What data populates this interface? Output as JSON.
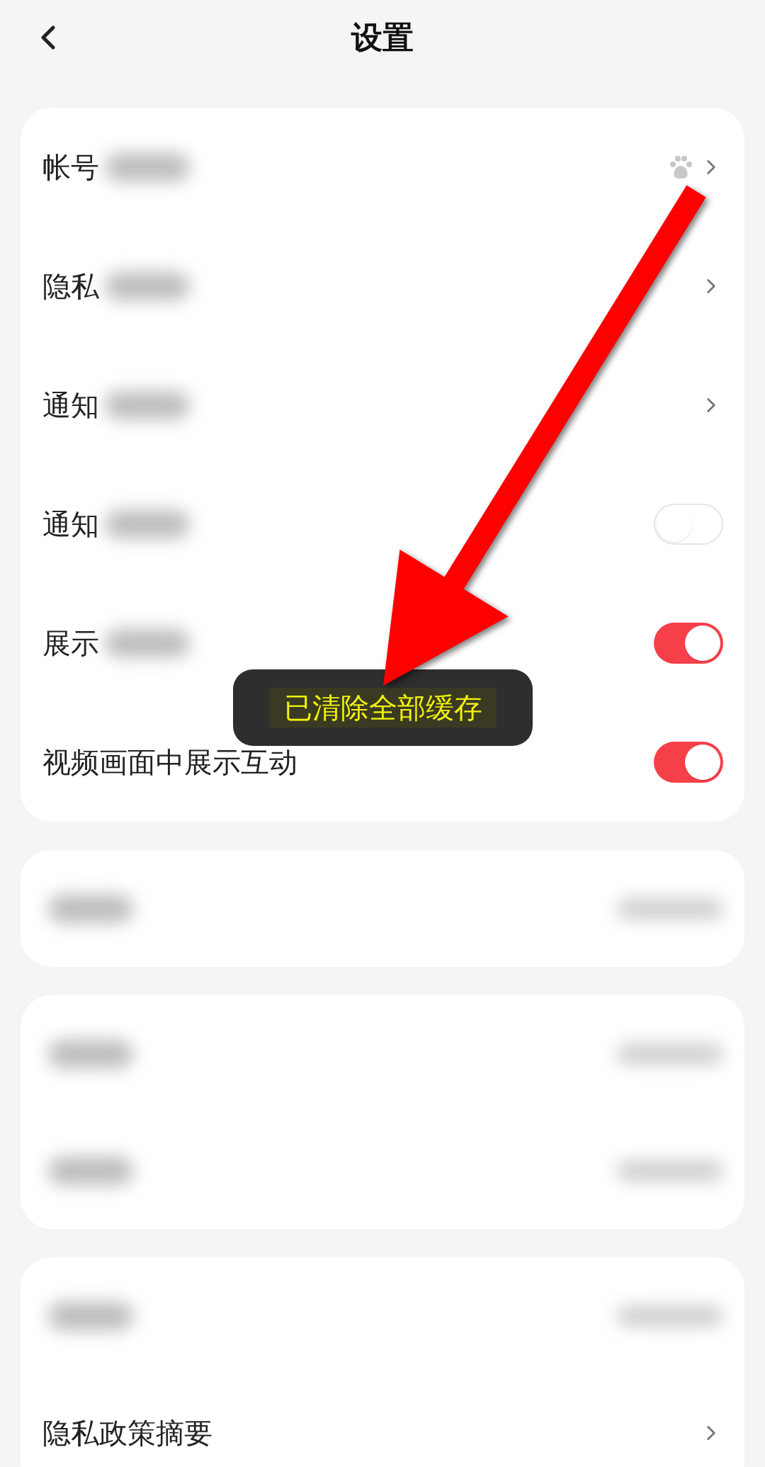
{
  "header": {
    "title": "设置"
  },
  "groups": [
    {
      "rows": [
        {
          "label": "帐号",
          "kind": "paw_chevron"
        },
        {
          "label": "隐私",
          "kind": "chevron"
        },
        {
          "label": "通知",
          "kind": "chevron"
        },
        {
          "label": "通知",
          "kind": "toggle",
          "on": false
        },
        {
          "label": "展示",
          "kind": "toggle",
          "on": true
        },
        {
          "label": "视频画面中展示互动",
          "kind": "toggle",
          "on": true
        }
      ]
    },
    {
      "rows": [
        {
          "kind": "blurred"
        }
      ]
    },
    {
      "rows": [
        {
          "kind": "blurred"
        },
        {
          "kind": "blurred"
        }
      ]
    },
    {
      "rows": [
        {
          "kind": "blurred"
        },
        {
          "label": "隐私政策摘要",
          "kind": "chevron"
        }
      ]
    }
  ],
  "toast": {
    "text": "已清除全部缓存"
  }
}
